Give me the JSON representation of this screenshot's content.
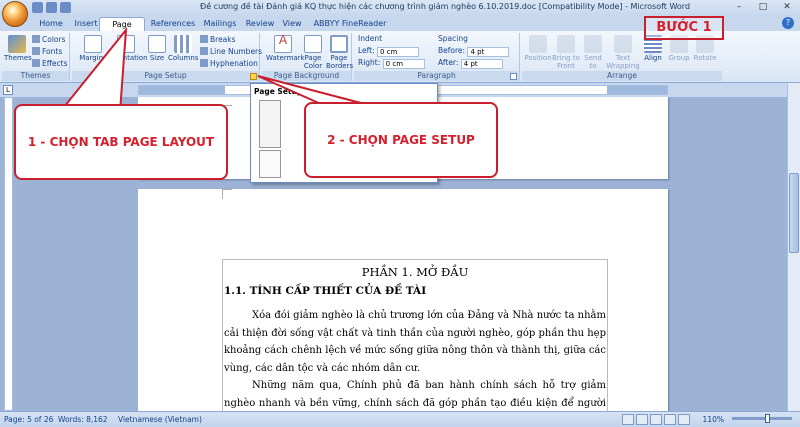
{
  "window": {
    "title": "Đề cương đề tài Đánh giá KQ thực hiện các chương trình giảm nghèo 6.10.2019.doc [Compatibility Mode] - Microsoft Word",
    "minimize": "–",
    "maximize": "□",
    "close": "✕"
  },
  "tabs": [
    {
      "label": "Home"
    },
    {
      "label": "Insert"
    },
    {
      "label": "Page Layout",
      "active": true
    },
    {
      "label": "References"
    },
    {
      "label": "Mailings"
    },
    {
      "label": "Review"
    },
    {
      "label": "View"
    },
    {
      "label": "ABBYY FineReader 12"
    }
  ],
  "ribbon": {
    "themes": {
      "group": "Themes",
      "themes_btn": "Themes",
      "colors": "Colors",
      "fonts": "Fonts",
      "effects": "Effects"
    },
    "page_setup": {
      "group": "Page Setup",
      "margins": "Margins",
      "orientation": "Orientation",
      "size": "Size",
      "columns": "Columns",
      "breaks": "Breaks",
      "line_numbers": "Line Numbers",
      "hyphenation": "Hyphenation"
    },
    "page_background": {
      "group": "Page Background",
      "watermark": "Watermark",
      "page_color": "Page Color",
      "page_borders": "Page Borders"
    },
    "paragraph": {
      "group": "Paragraph",
      "indent": "Indent",
      "left": "Left:",
      "left_val": "0 cm",
      "right": "Right:",
      "right_val": "0 cm",
      "spacing": "Spacing",
      "before": "Before:",
      "before_val": "4 pt",
      "after": "After:",
      "after_val": "4 pt"
    },
    "arrange": {
      "group": "Arrange",
      "position": "Position",
      "bring_front": "Bring to Front",
      "send_back": "Send to Back",
      "text_wrapping": "Text Wrapping",
      "align": "Align",
      "group_btn": "Group",
      "rotate": "Rotate"
    }
  },
  "popup": {
    "title": "Page Setup"
  },
  "annotations": {
    "step": "BƯỚC 1",
    "callout1": "1 - CHỌN TAB PAGE LAYOUT",
    "callout2": "2 - CHỌN PAGE SETUP"
  },
  "document": {
    "heading1": "PHẦN 1. MỞ ĐẦU",
    "heading2": "1.1. TÍNH CẤP THIẾT CỦA ĐỀ TÀI",
    "para1": "Xóa đói giảm nghèo là chủ trương lớn của Đảng và Nhà nước ta nhằm cải thiện đời sống vật chất và tinh thần của người nghèo, góp phần thu hẹp khoảng cách chênh lệch về mức sống giữa nông thôn và thành thị, giữa các vùng, các dân tộc và các nhóm dân cư.",
    "para2": "Những năm qua, Chính phủ đã ban hành chính sách hỗ trợ giảm nghèo nhanh và bền vững, chính sách đã góp phần tạo điều kiện để người nghèo tiếp cận tốt hơn"
  },
  "status": {
    "page": "Page: 5 of 26",
    "words": "Words: 8,162",
    "language": "Vietnamese (Vietnam)",
    "zoom": "110%"
  },
  "colors": {
    "accent": "#c81e2d",
    "ribbon": "#dae6f5",
    "tab_text": "#15428b"
  }
}
